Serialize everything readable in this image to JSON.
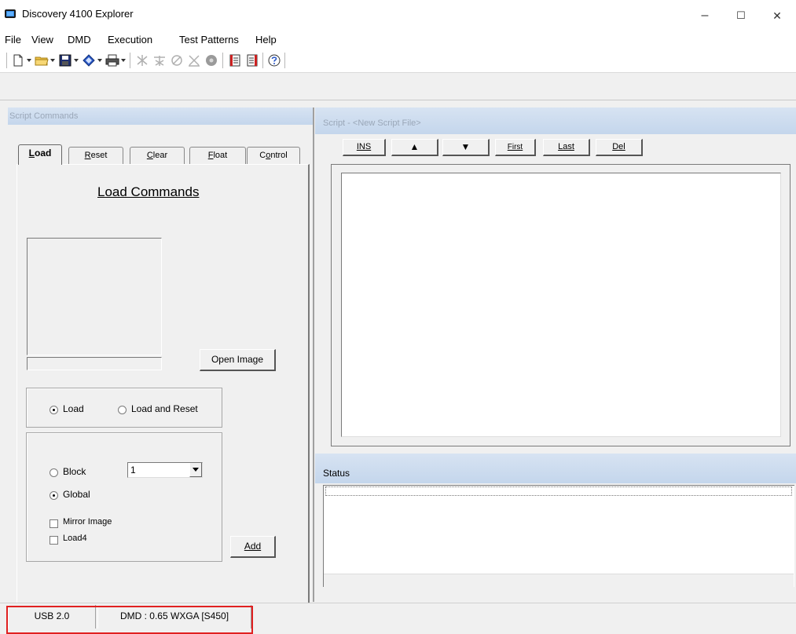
{
  "window": {
    "title": "Discovery 4100 Explorer",
    "minimize_glyph": "–",
    "maximize_glyph": "☐",
    "close_glyph": "✕"
  },
  "menu": [
    "File",
    "View",
    "DMD",
    "Execution",
    "Test Patterns",
    "Help"
  ],
  "toolbar": {
    "icons": [
      "new-file-icon",
      "open-folder-icon",
      "save-icon",
      "paint-bucket-icon",
      "print-icon",
      "tool-1-icon",
      "tool-2-icon",
      "tool-3-icon",
      "tool-4-icon",
      "record-icon",
      "doc-red-icon",
      "doc-list-icon",
      "help-icon"
    ]
  },
  "left_panel": {
    "header": "Script Commands",
    "tabs": [
      {
        "label": "Load",
        "accel": "L",
        "rest": "oad",
        "active": true
      },
      {
        "label": "Reset",
        "accel": "R",
        "rest": "eset"
      },
      {
        "label": "Clear",
        "accel": "C",
        "rest": "lear"
      },
      {
        "label": "Float",
        "accel": "F",
        "rest": "loat"
      },
      {
        "label": "Control",
        "pre": "C",
        "accel": "o",
        "rest": "ntrol"
      }
    ],
    "load_title": "Load Commands",
    "open_image_label": "Open Image",
    "mode_group": {
      "options": [
        {
          "label": "Load",
          "checked": true
        },
        {
          "label": "Load and Reset",
          "checked": false
        }
      ]
    },
    "target_group": {
      "block_label": "Block",
      "block_checked": false,
      "block_value": "1",
      "global_label": "Global",
      "global_checked": true,
      "mirror_label": "Mirror Image",
      "load4_label": "Load4",
      "add_label": "Add"
    }
  },
  "script_panel": {
    "header": "Script - <New Script File>",
    "buttons": {
      "ins": "INS",
      "up": "▲",
      "down": "▼",
      "first": "First",
      "last": "Last",
      "del": "Del"
    }
  },
  "status_panel": {
    "header": "Status"
  },
  "statusbar": {
    "connection": "USB 2.0",
    "device": "DMD : 0.65 WXGA [S450]"
  },
  "colors": {
    "header_gradient_top": "#d7e3f2",
    "header_gradient_bottom": "#c4d6ec",
    "highlight_border": "#e02020"
  }
}
